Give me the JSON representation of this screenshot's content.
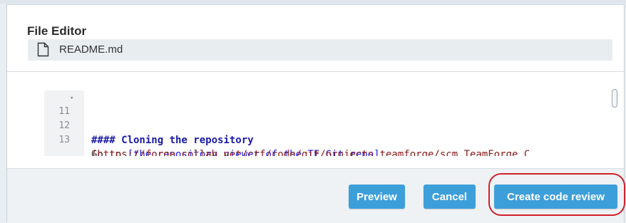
{
  "dialog": {
    "title": "File Editor",
    "file": {
      "icon": "file-icon",
      "name": "README.md"
    }
  },
  "editor": {
    "lines": [
      {
        "number": "11",
        "fold_icon": "fold-arrow-icon",
        "text": "#### Cloning the repository"
      },
      {
        "number": "12",
        "text": ""
      },
      {
        "number": "13",
        "text_prefix": "Go to ",
        "link_text": "[the repository viewer of the TF Git repo]",
        "url_text": "(https://forge.collab.net/ctf/code/git/projects.teamforge/scm.TeamForge_C"
      }
    ]
  },
  "footer": {
    "preview_label": "Preview",
    "cancel_label": "Cancel",
    "create_review_label": "Create code review"
  },
  "colors": {
    "button": "#3d9fd9",
    "highlight": "#d2202a",
    "heading": "#1a1aa6",
    "url": "#8b1a1a"
  }
}
